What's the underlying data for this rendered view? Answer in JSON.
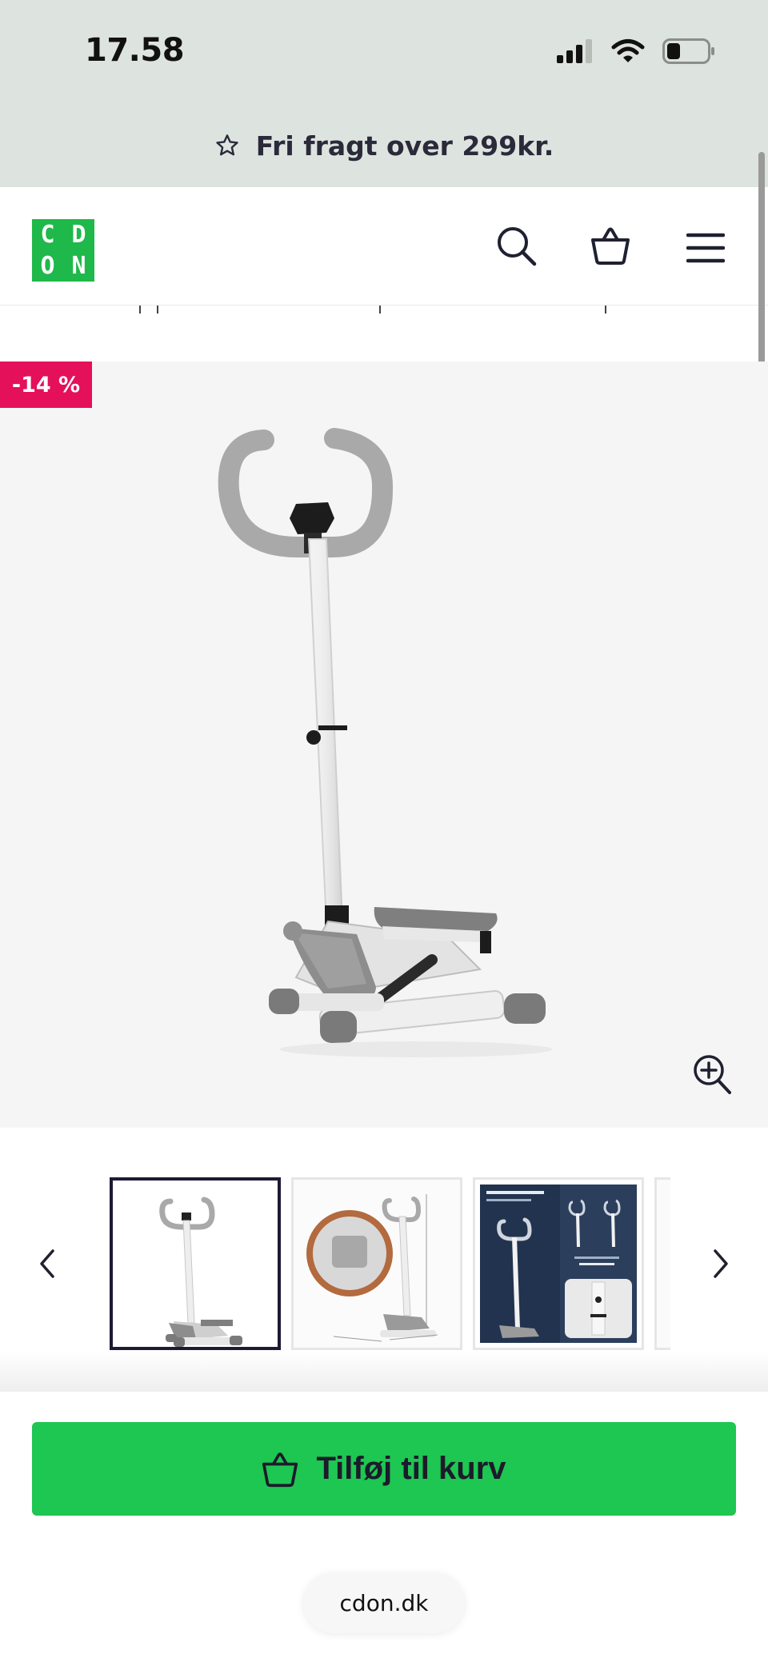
{
  "status_bar": {
    "time": "17.58",
    "icons": [
      "signal-icon",
      "wifi-icon",
      "battery-icon"
    ]
  },
  "promo": {
    "text": "Fri fragt over 299kr.",
    "icon": "star-icon"
  },
  "header": {
    "logo_letters": [
      "C",
      "D",
      "O",
      "N"
    ],
    "icons": [
      "search-icon",
      "basket-icon",
      "menu-icon"
    ]
  },
  "product": {
    "discount_badge": "-14 %",
    "zoom_icon": "zoom-in-icon"
  },
  "gallery": {
    "prev_icon": "chevron-left-icon",
    "next_icon": "chevron-right-icon",
    "active_index": 0,
    "thumbnail_count": 3
  },
  "cart": {
    "button_label": "Tilføj til kurv",
    "icon": "basket-icon"
  },
  "browser": {
    "url": "cdon.dk"
  },
  "colors": {
    "brand_green": "#1fb84a",
    "cart_green": "#1ec652",
    "discount_pink": "#e5105a",
    "promo_bg": "#dde3de",
    "active_thumb_border": "#1e1a34"
  }
}
